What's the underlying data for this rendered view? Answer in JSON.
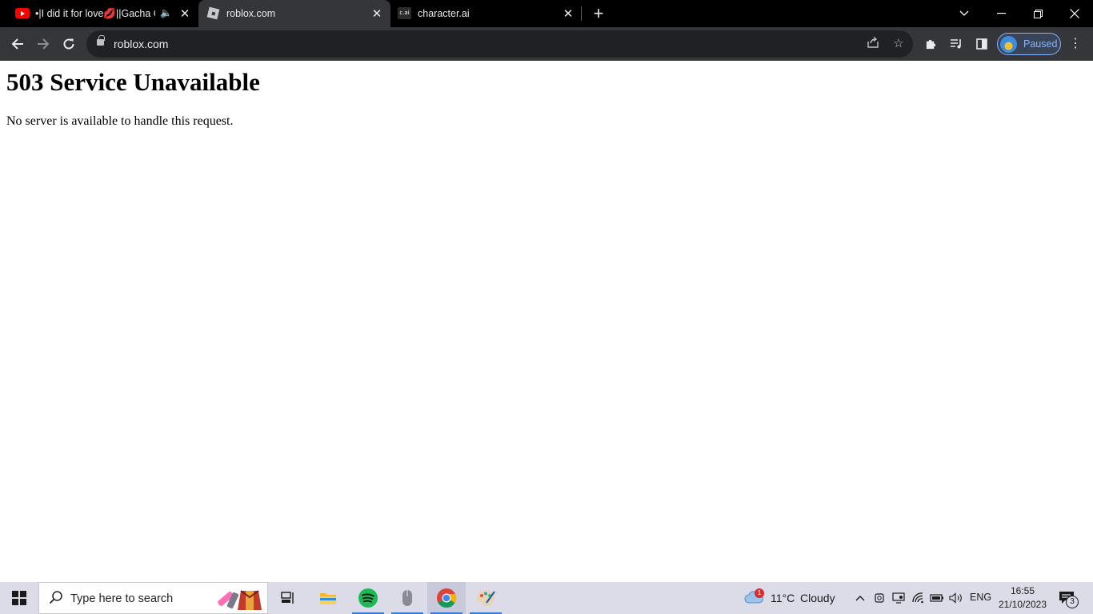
{
  "browser": {
    "tabs": [
      {
        "title": "•|I did it for love💋||Gacha C",
        "icon": "youtube-icon",
        "audio": true,
        "active": false
      },
      {
        "title": "roblox.com",
        "icon": "roblox-icon",
        "active": true
      },
      {
        "title": "character.ai",
        "icon": "character-ai-icon",
        "icon_text": "c.ai",
        "active": false
      }
    ],
    "address": "roblox.com",
    "profile_label": "Paused"
  },
  "page": {
    "heading": "503 Service Unavailable",
    "message": "No server is available to handle this request."
  },
  "taskbar": {
    "search_placeholder": "Type here to search",
    "weather": {
      "temp": "11°C",
      "condition": "Cloudy",
      "badge": "1"
    },
    "language": "ENG",
    "time": "16:55",
    "date": "21/10/2023",
    "notification_count": "3"
  },
  "colors": {
    "tabstrip_bg": "#000000",
    "toolbar_bg": "#35363a",
    "omnibox_bg": "#202124",
    "profile_accent": "#8ab4f8",
    "taskbar_bg": "#dcdce8"
  }
}
